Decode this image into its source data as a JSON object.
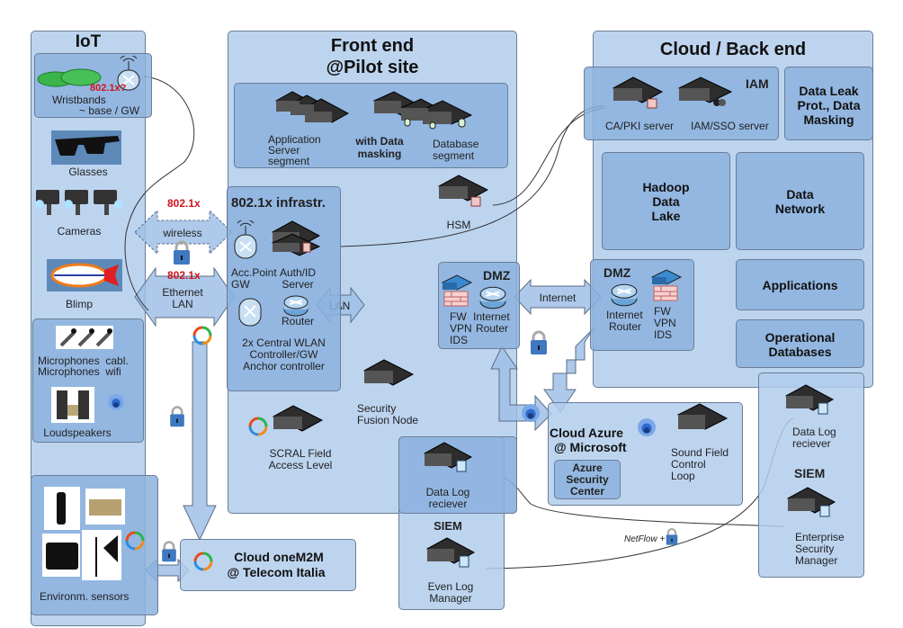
{
  "iot": {
    "title": "IoT",
    "wristbands": "Wristbands",
    "base_gw": "~ base / GW",
    "wristband_protocol": "802.1x?",
    "glasses": "Glasses",
    "cameras": "Cameras",
    "blimp": "Blimp",
    "microphones_line1": "Microphones  cabl.",
    "microphones_line2": "Microphones  wifi",
    "loudspeakers": "Loudspeakers",
    "env_sensors": "Environm. sensors"
  },
  "links": {
    "wireless_8021x": "802.1x",
    "wireless": "wireless",
    "ethernet_8021x": "802.1x",
    "ethernet_line1": "Ethernet",
    "ethernet_line2": "LAN",
    "lan": "LAN",
    "internet": "Internet",
    "netflow": "NetFlow +"
  },
  "frontend": {
    "title_line1": "Front end",
    "title_line2": "@Pilot site",
    "app_server_line1": "Application",
    "app_server_line2": "Server",
    "app_server_line3": "segment",
    "data_masking_line1": "with Data",
    "data_masking_line2": "masking",
    "db_segment_line1": "Database",
    "db_segment_line2": "segment",
    "hsm": "HSM",
    "infra_title": "802.1x infrastr.",
    "acc_point_line1": "Acc.Point",
    "acc_point_line2": "GW",
    "auth_line1": "Auth/ID",
    "auth_line2": "Server",
    "router": "Router",
    "wlan_line1": "2x Central WLAN",
    "wlan_line2": "Controller/GW",
    "wlan_line3": "Anchor controller",
    "dmz_title": "DMZ",
    "dmz_fw_line1": "FW",
    "dmz_fw_line2": "VPN",
    "dmz_fw_line3": "IDS",
    "dmz_router_line1": "Internet",
    "dmz_router_line2": "Router",
    "security_fusion_line1": "Security",
    "security_fusion_line2": "Fusion Node",
    "scral_line1": "SCRAL Field",
    "scral_line2": "Access Level",
    "siem_title": "SIEM",
    "data_log_line1": "Data Log",
    "data_log_line2": "reciever",
    "even_log_line1": "Even Log",
    "even_log_line2": "Manager"
  },
  "cloud": {
    "title": "Cloud / Back end",
    "iam_title": "IAM",
    "ca_pki": "CA/PKI server",
    "iam_sso": "IAM/SSO server",
    "dlp_line1": "Data Leak",
    "dlp_line2": "Prot., Data",
    "dlp_line3": "Masking",
    "hadoop_line1": "Hadoop",
    "hadoop_line2": "Data",
    "hadoop_line3": "Lake",
    "data_network_line1": "Data",
    "data_network_line2": "Network",
    "applications": "Applications",
    "opdb_line1": "Operational",
    "opdb_line2": "Databases",
    "dmz_title": "DMZ",
    "dmz_router_line1": "Internet",
    "dmz_router_line2": "Router",
    "dmz_fw_line1": "FW",
    "dmz_fw_line2": "VPN",
    "dmz_fw_line3": "IDS",
    "siem_title": "SIEM",
    "data_log_line1": "Data Log",
    "data_log_line2": "reciever",
    "esm_line1": "Enterprise",
    "esm_line2": "Security",
    "esm_line3": "Manager"
  },
  "azure": {
    "title_line1": "Cloud Azure",
    "title_line2": "@ Microsoft",
    "asc_line1": "Azure",
    "asc_line2": "Security",
    "asc_line3": "Center",
    "sound_line1": "Sound Field",
    "sound_line2": "Control",
    "sound_line3": "Loop"
  },
  "onem2m": {
    "title_line1": "Cloud oneM2M",
    "title_line2": "@ Telecom Italia"
  },
  "colors": {
    "panel": "#b2cdec",
    "panel_dark": "#8cb2de",
    "border": "#6a7d96",
    "protocol_red": "#d0141c",
    "lock_blue": "#3f78c0"
  }
}
